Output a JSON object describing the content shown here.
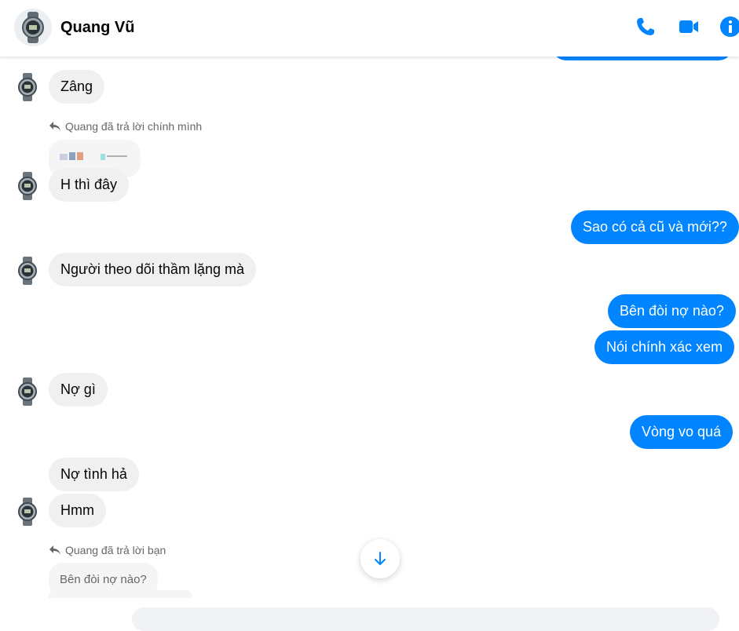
{
  "header": {
    "contact_name": "Quang Vũ",
    "icons": [
      "phone-icon",
      "video-camera-icon",
      "info-icon"
    ],
    "accent_color": "#0084ff"
  },
  "messages": {
    "m1": "Zâng",
    "reply1_label": "Quang đã trả lời chính mình",
    "m2": "H thì đây",
    "m3": "Sao có cả cũ và mới??",
    "m4": "Người theo dõi thầm lặng mà",
    "m5": "Bên đòi nợ nào?",
    "m6": "Nói chính xác xem",
    "m7": "Nợ gì",
    "m8": "Vòng vo quá",
    "m9": "Nợ tình hả",
    "m10": "Hmm",
    "reply2_label": "Quang đã trả lời bạn",
    "reply2_quote": "Bên đòi nợ nào?"
  },
  "colors": {
    "outgoing_bubble": "#0084ff",
    "incoming_bubble": "#f0f0f0",
    "secondary_text": "#65676b"
  }
}
